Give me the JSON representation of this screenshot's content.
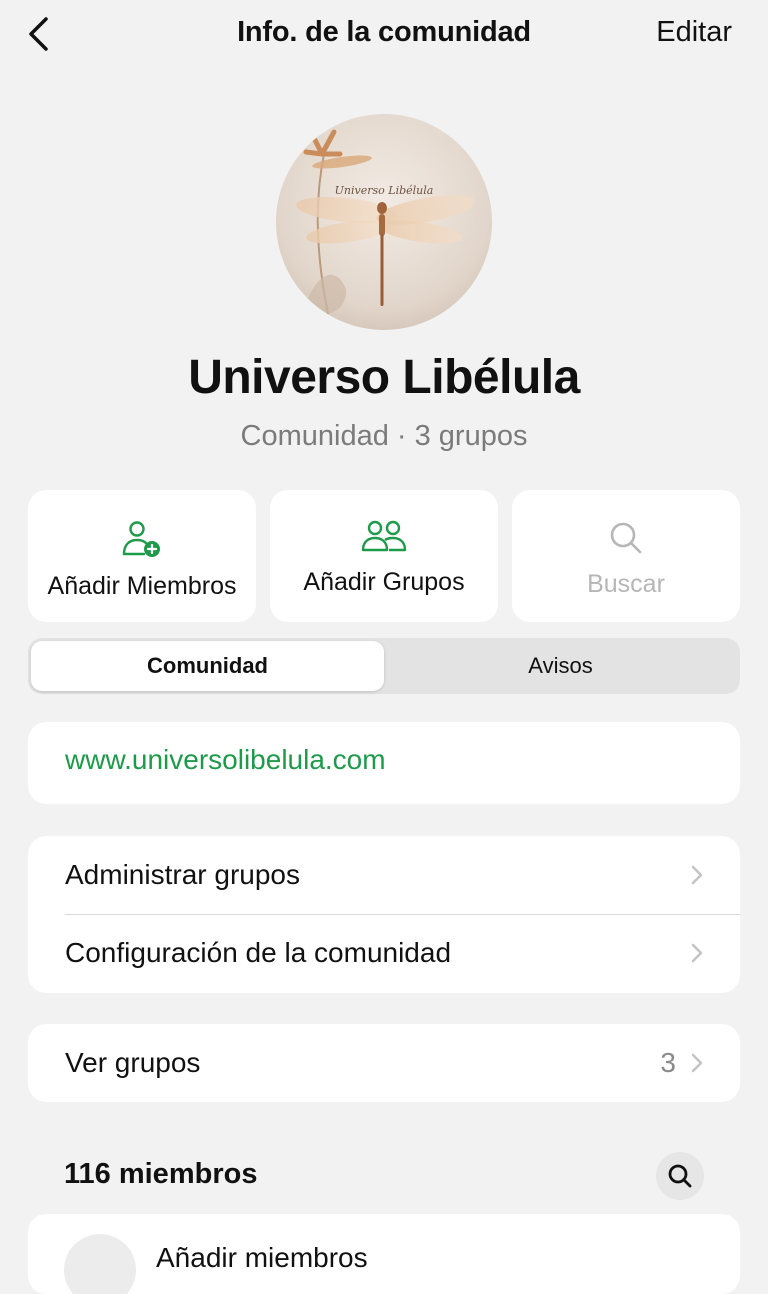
{
  "nav": {
    "title": "Info. de la comunidad",
    "edit_label": "Editar"
  },
  "community": {
    "name": "Universo Libélula",
    "subtitle": "Comunidad · 3 grupos",
    "avatar_text": "Universo Libélula"
  },
  "actions": [
    {
      "label": "Añadir Miembros",
      "icon": "add-person-icon"
    },
    {
      "label": "Añadir Grupos",
      "icon": "groups-icon"
    },
    {
      "label": "Buscar",
      "icon": "search-icon"
    }
  ],
  "tabs": [
    {
      "label": "Comunidad",
      "active": true
    },
    {
      "label": "Avisos",
      "active": false
    }
  ],
  "website": "www.universolibelula.com",
  "menu": [
    {
      "label": "Administrar grupos"
    },
    {
      "label": "Configuración de la comunidad"
    }
  ],
  "groups_row": {
    "label": "Ver grupos",
    "count": "3"
  },
  "members": {
    "header": "116 miembros",
    "add_label": "Añadir miembros"
  },
  "colors": {
    "accent_green": "#1e9a4a",
    "background": "#f2f2f2",
    "card": "#ffffff",
    "muted": "#7b7b7b"
  }
}
